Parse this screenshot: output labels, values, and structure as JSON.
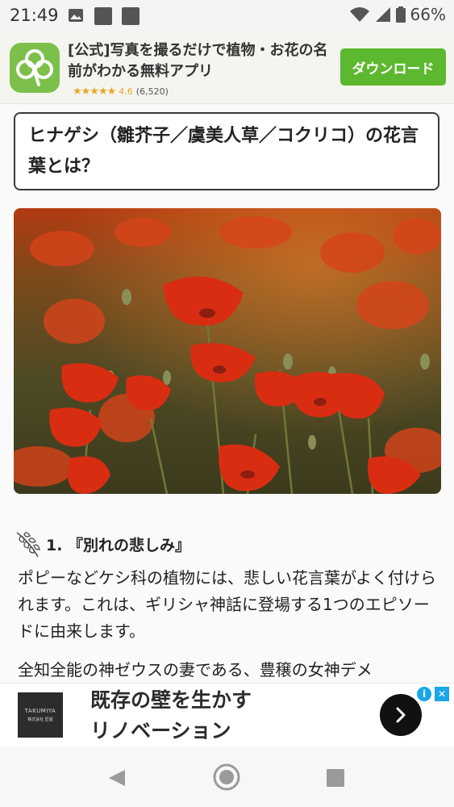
{
  "status_bar": {
    "time": "21:49",
    "battery_percent": "66%",
    "icons": [
      "image-icon",
      "square-notification-icon",
      "square-notification-icon",
      "wifi-icon",
      "signal-icon",
      "battery-icon"
    ]
  },
  "top_ad": {
    "title": "[公式]写真を撮るだけで植物・お花の名前がわかる無料アプリ",
    "rating_stars": "★★★★★",
    "rating_value": "4.6",
    "rating_count": "(6,520)",
    "download_label": "ダウンロード",
    "icon": "clover-icon",
    "accent_color": "#5cb82e"
  },
  "article": {
    "title": "ヒナゲシ（雛芥子／虞美人草／コクリコ）の花言葉とは？",
    "section1_heading": "1. 『別れの悲しみ』",
    "paragraph1": "ポピーなどケシ科の植物には、悲しい花言葉がよく付けられます。これは、ギリシャ神話に登場する1つのエピソードに由来します。",
    "paragraph2": "全知全能の神ゼウスの妻である、豊穣の女神デメ"
  },
  "bottom_ad": {
    "brand_name": "TAKUMIYA",
    "brand_sub": "株式会社 匠屋",
    "line1": "既存の壁を生かす",
    "line2": "リノベーション",
    "icons": [
      "info-icon",
      "close-icon",
      "chevron-right-icon"
    ]
  },
  "nav_bar": {
    "icons": [
      "back-icon",
      "home-icon",
      "recents-icon"
    ]
  }
}
